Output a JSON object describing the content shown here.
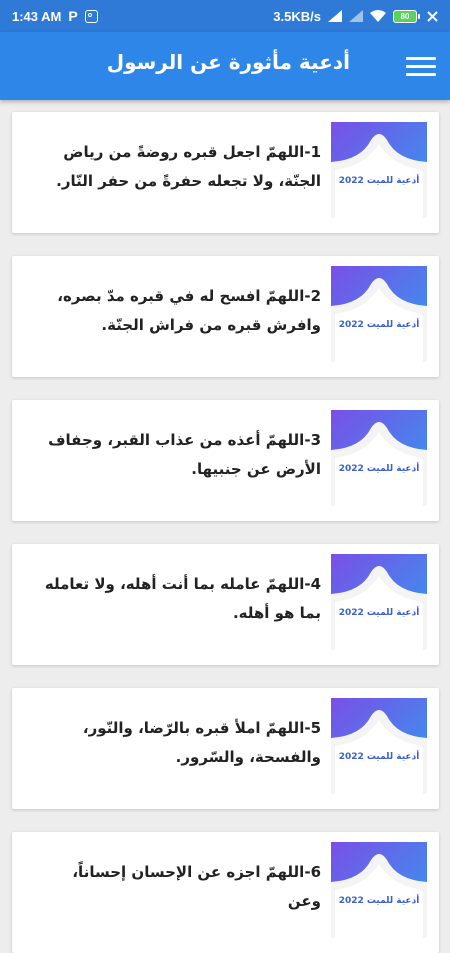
{
  "status_bar": {
    "time": "1:43 AM",
    "speed": "3.5KB/s",
    "battery": "80"
  },
  "app_bar": {
    "title": "أدعية مأثورة عن الرسول",
    "menu_icon": "hamburger-menu-icon"
  },
  "colors": {
    "status_bar": "#2e7ad6",
    "app_bar": "#2e86e8",
    "background": "#ededed",
    "card": "#ffffff"
  },
  "thumbnail_label": "أدعية للميت 2022",
  "items": [
    {
      "text": "1-اللهمّ اجعل قبره روضةً من رياض الجنّة، ولا تجعله حفرةً من حفر النّار."
    },
    {
      "text": "2-اللهمّ افسح له في قبره مدّ بصره، وافرش قبره من فراش الجنّة."
    },
    {
      "text": "3-اللهمّ أعذه من عذاب القبر، وجفاف الأرض عن جنبيها."
    },
    {
      "text": "4-اللهمّ عامله بما أنت أهله، ولا تعامله بما هو أهله."
    },
    {
      "text": "5-اللهمّ املأ قبره بالرّضا، والنّور، والفسحة، والسّرور."
    },
    {
      "text": "6-اللهمّ اجزه عن الإحسان إحساناً، وعن"
    }
  ]
}
